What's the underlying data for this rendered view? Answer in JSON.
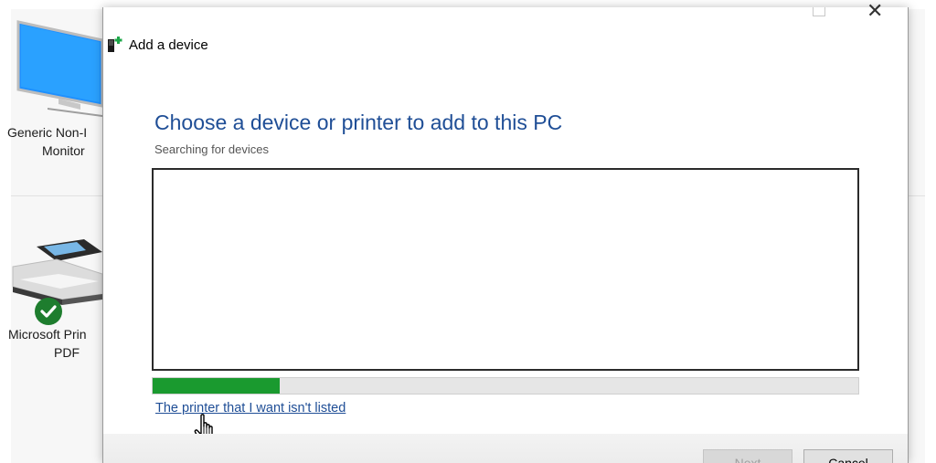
{
  "background": {
    "devices": [
      {
        "label_line1": "Generic Non-I",
        "label_line2": "Monitor"
      },
      {
        "label_line1": "Microsoft Prin",
        "label_line2": "PDF"
      }
    ]
  },
  "dialog": {
    "title": "Add a device",
    "heading": "Choose a device or printer to add to this PC",
    "status": "Searching for devices",
    "progress": 0.18,
    "link": "The printer that I want isn't listed",
    "buttons": {
      "next": "Next",
      "cancel": "Cancel"
    }
  },
  "colors": {
    "heading": "#1f4e96",
    "progress": "#1a9a2f",
    "link": "#1f4e96"
  },
  "icons": [
    "monitor-icon",
    "printer-icon",
    "checkmark-icon",
    "add-device-icon",
    "hand-cursor-icon"
  ]
}
